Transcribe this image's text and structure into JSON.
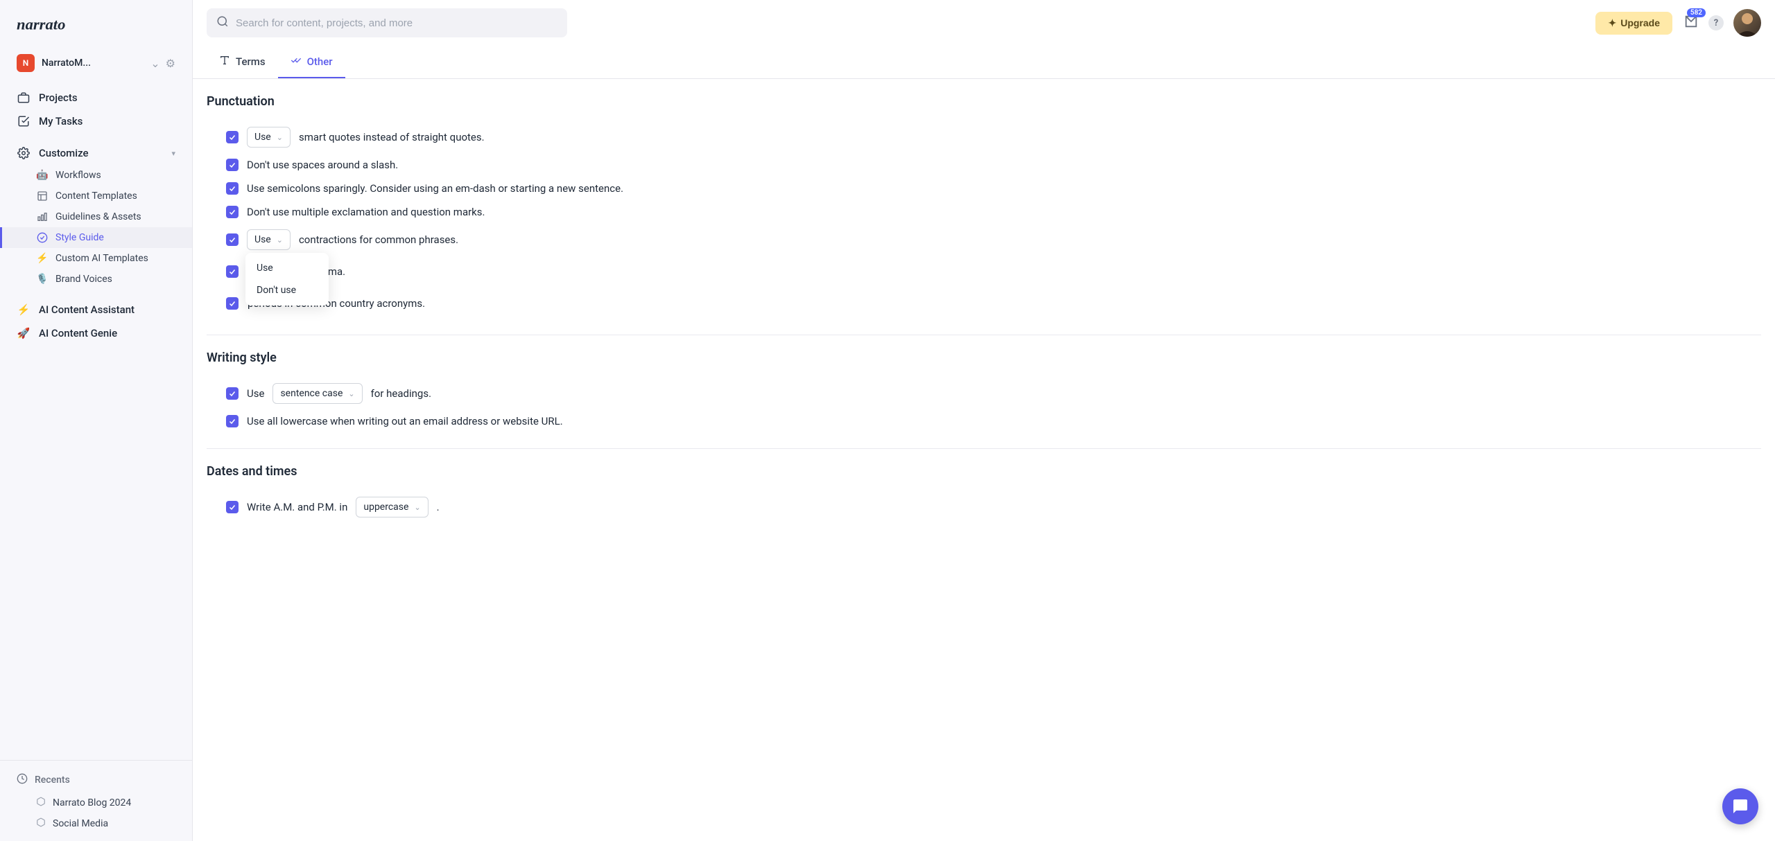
{
  "workspace": {
    "badge": "N",
    "name": "NarratoM..."
  },
  "sidebar": {
    "projects": "Projects",
    "my_tasks": "My Tasks",
    "customize": "Customize",
    "customize_items": [
      {
        "label": "Workflows",
        "icon": "robot"
      },
      {
        "label": "Content Templates",
        "icon": "templates"
      },
      {
        "label": "Guidelines & Assets",
        "icon": "assets"
      },
      {
        "label": "Style Guide",
        "icon": "check-circle",
        "active": true
      },
      {
        "label": "Custom AI Templates",
        "icon": "bolt"
      },
      {
        "label": "Brand Voices",
        "icon": "mic"
      }
    ],
    "ai_assistant": "AI Content Assistant",
    "ai_genie": "AI Content Genie",
    "recents_label": "Recents",
    "recents": [
      {
        "label": "Narrato Blog 2024"
      },
      {
        "label": "Social Media"
      }
    ]
  },
  "search": {
    "placeholder": "Search for content, projects, and more"
  },
  "upgrade": "Upgrade",
  "notifications_count": "582",
  "tabs": [
    {
      "label": "Terms",
      "active": false
    },
    {
      "label": "Other",
      "active": true
    }
  ],
  "sections": {
    "punctuation": {
      "title": "Punctuation",
      "rules": {
        "smart_quotes": {
          "select": "Use",
          "text": "smart quotes instead of straight quotes."
        },
        "slash": "Don't use spaces around a slash.",
        "semicolons": "Use semicolons sparingly. Consider using an em-dash or starting a new sentence.",
        "exclamation": "Don't use multiple exclamation and question marks.",
        "contractions": {
          "select": "Use",
          "text": "contractions for common phrases."
        },
        "oxford_suffix": "xford comma.",
        "country_acronyms": {
          "text": "periods in common country acronyms."
        }
      }
    },
    "writing_style": {
      "title": "Writing style",
      "rules": {
        "headings": {
          "prefix": "Use",
          "select": "sentence case",
          "suffix": "for headings."
        },
        "lowercase_url": "Use all lowercase when writing out an email address or website URL."
      }
    },
    "dates_times": {
      "title": "Dates and times",
      "rules": {
        "ampm": {
          "prefix": "Write A.M. and P.M. in",
          "select": "uppercase",
          "suffix": "."
        }
      }
    }
  },
  "dropdown": {
    "opt1": "Use",
    "opt2": "Don't use"
  }
}
